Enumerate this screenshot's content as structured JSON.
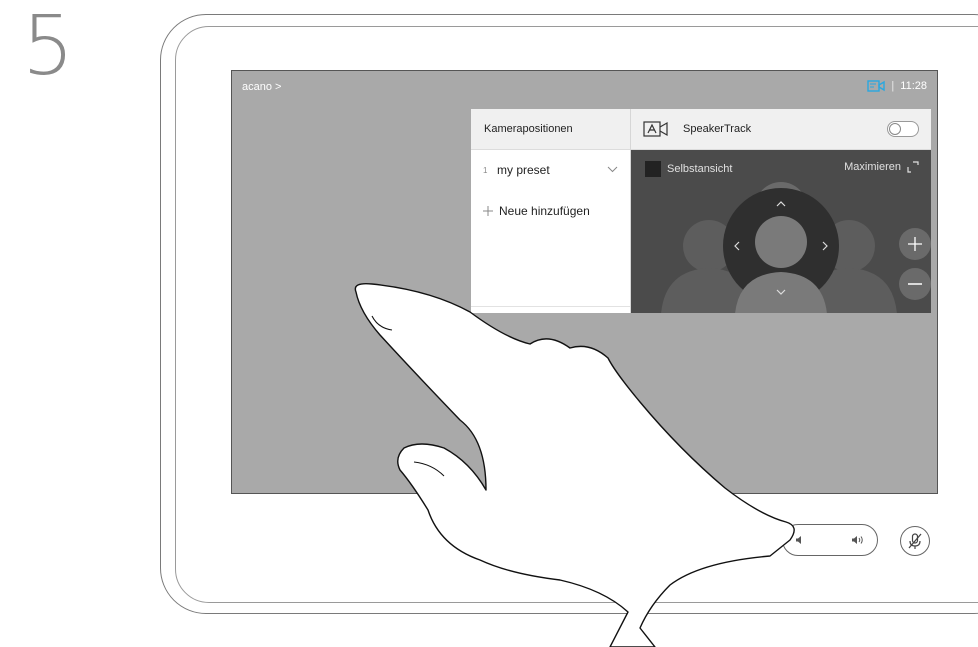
{
  "step": {
    "number": "5"
  },
  "screen": {
    "breadcrumb": "acano >",
    "clock": "11:28",
    "separator": "|"
  },
  "presets_panel": {
    "header": "Kamerapositionen",
    "items": [
      {
        "index": "1",
        "label": "my preset"
      }
    ],
    "add_label": "Neue hinzufügen"
  },
  "camera_panel": {
    "speakertrack_label": "SpeakerTrack",
    "speakertrack_on": false,
    "selfview_label": "Selbstansicht",
    "maximize_label": "Maximieren"
  },
  "colors": {
    "screen_bg": "#a9a9a9",
    "camera_icon_active": "#29a8e0",
    "preview_bg": "#4b4b4b"
  }
}
